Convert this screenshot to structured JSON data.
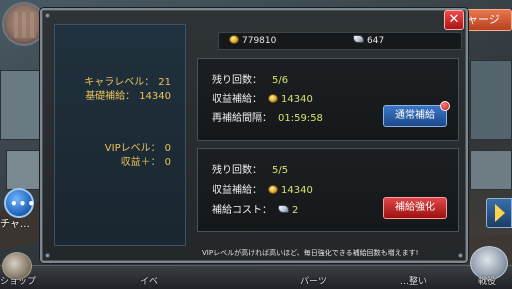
{
  "top": {
    "charge_label": "ャージ",
    "close_label": "✕"
  },
  "side": {
    "chat_label": "チャ…",
    "chat_dots": "•••"
  },
  "bottom_nav": {
    "items": [
      "ショップ",
      "イベ",
      "",
      "",
      "",
      "パーツ",
      "",
      "…整い",
      "戦役"
    ]
  },
  "status": {
    "chara_level_label": "キャラレベル：",
    "chara_level_value": "21",
    "base_supply_label": "基礎補給：",
    "base_supply_value": "14340",
    "vip_level_label": "VIPレベル：",
    "vip_level_value": "0",
    "revenue_plus_label": "収益＋：",
    "revenue_plus_value": "0"
  },
  "currency": {
    "coins": "779810",
    "gems": "647"
  },
  "normal_supply": {
    "remaining_label": "残り回数：",
    "remaining_value": "5/6",
    "income_label": "収益補給：",
    "income_value": "14340",
    "interval_label": "再補給間隔：",
    "interval_value": "01:59:58",
    "button_label": "通常補給"
  },
  "boost_supply": {
    "remaining_label": "残り回数：",
    "remaining_value": "5/5",
    "income_label": "収益補給：",
    "income_value": "14340",
    "cost_label": "補給コスト：",
    "cost_value": "2",
    "button_label": "補給強化"
  },
  "notice": "VIPレベルが高ければ高いほど、毎日強化できる補給回数も増えます!",
  "icons": {
    "coin": "coin-icon",
    "gem": "gem-icon",
    "notification": "notification-dot-icon"
  },
  "colors": {
    "accent_gold": "#ecc35a",
    "normal_button": "#2a5fa8",
    "boost_button": "#c22a2a"
  }
}
